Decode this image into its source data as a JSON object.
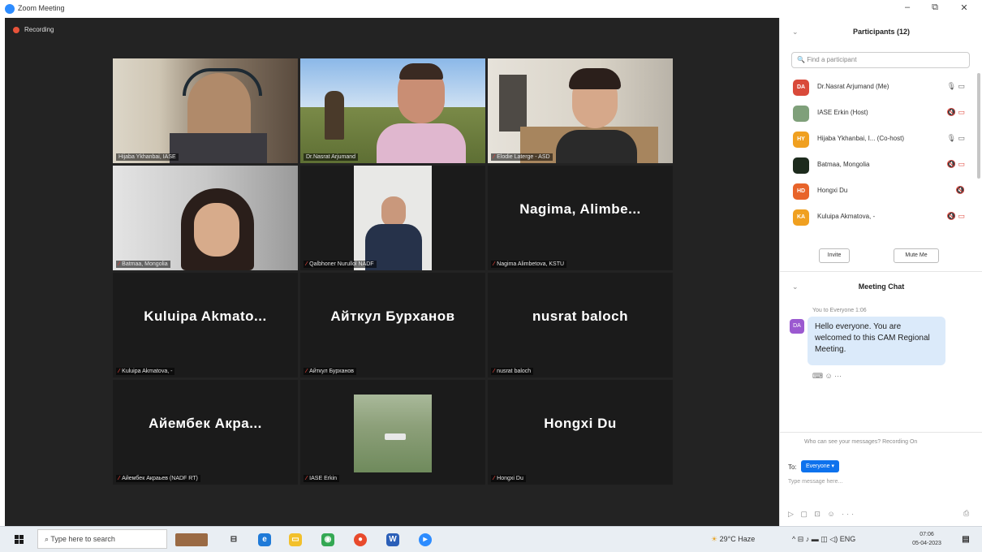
{
  "window": {
    "title": "Zoom Meeting",
    "minimize": "–",
    "restore": "⧉",
    "close": "✕"
  },
  "recording": {
    "label": "Recording"
  },
  "tiles": [
    {
      "label": "Hijaba Ykhanbai, IASE",
      "big": "",
      "active": true
    },
    {
      "label": "Dr.Nasrat Arjumand",
      "big": "",
      "active": false
    },
    {
      "label": "Elodie Laterge - ASD",
      "big": "",
      "active": false
    },
    {
      "label": "Batmaa, Mongolia",
      "big": "",
      "active": false
    },
    {
      "label": "Qalbhoner Nurullol NADF",
      "big": "",
      "active": false
    },
    {
      "label": "Nagima Alimbetova, KSTU",
      "big": "Nagima,  Alimbe...",
      "active": false
    },
    {
      "label": "Kuluipa Akmatova, -",
      "big": "Kuluipa  Akmato...",
      "active": false
    },
    {
      "label": "Айткул Бурханов",
      "big": "Айткул Бурханов",
      "active": false
    },
    {
      "label": "nusrat baloch",
      "big": "nusrat baloch",
      "active": false
    },
    {
      "label": "Айембек Акраьев (NADF RT)",
      "big": "Айембек  Акра...",
      "active": false
    },
    {
      "label": "IASE Erkin",
      "big": "",
      "active": false
    },
    {
      "label": "Hongxi Du",
      "big": "Hongxi Du",
      "active": false
    }
  ],
  "participants": {
    "title": "Participants (12)",
    "search_placeholder": "Find a participant",
    "items": [
      {
        "initials": "DA",
        "color": "#d94a3a",
        "name": "Dr.Nasrat Arjumand (Me)",
        "icons": "🎙 ▭"
      },
      {
        "initials": "",
        "color": "#7fa07a",
        "name": "IASE Erkin (Host)",
        "icons": "🔇 ▭"
      },
      {
        "initials": "HY",
        "color": "#f0a020",
        "name": "Hijaba Ykhanbai, I... (Co-host)",
        "icons": "🎙 ▭"
      },
      {
        "initials": "",
        "color": "#1d2b1d",
        "name": "Batmaa, Mongolia",
        "icons": "🔇 ▭"
      },
      {
        "initials": "HD",
        "color": "#e8642a",
        "name": "Hongxi Du",
        "icons": "🔇"
      },
      {
        "initials": "KA",
        "color": "#f0a020",
        "name": "Kuluipa Akmatova, -",
        "icons": "🔇 ▭"
      }
    ],
    "invite": "Invite",
    "mute_me": "Mute Me"
  },
  "chat": {
    "title": "Meeting Chat",
    "from": "You to Everyone 1:06",
    "avatar": "DA",
    "message": "Hello everyone. You are welcomed to this CAM Regional Meeting.",
    "reactions": "⌨ ☺ ···",
    "who_can": "Who can see your messages? Recording On",
    "to_label": "To:",
    "to_value": "Everyone ▾",
    "input_placeholder": "Type message here...",
    "tools": "▷ ▢ ⊡ ☺ ···",
    "send": "⎙"
  },
  "taskbar": {
    "search": "Type here to search",
    "weather": "29°C  Haze",
    "tray": "^ ⊟ ♪ ▬ ◫ ◁) ENG",
    "time": "07:06",
    "date": "05-04-2023"
  }
}
